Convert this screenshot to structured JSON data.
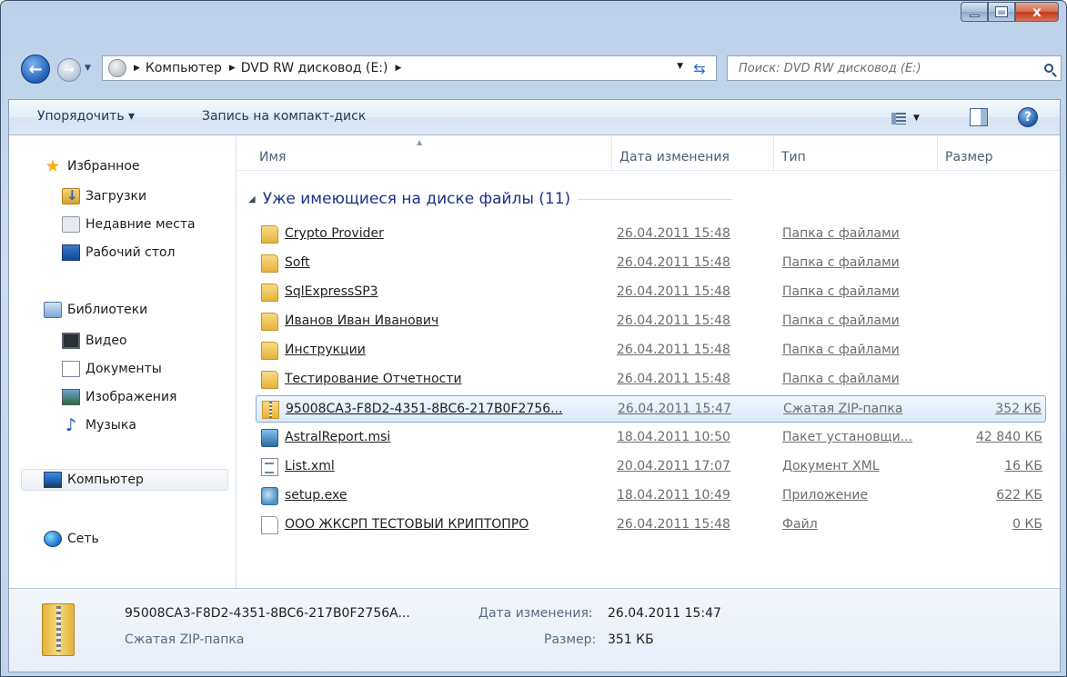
{
  "titlebar": {
    "minimize_icon": "minimize-icon",
    "maximize_icon": "maximize-icon",
    "close_glyph": "x"
  },
  "address": {
    "crumbs": [
      "Компьютер",
      "DVD RW дисковод (E:)"
    ],
    "search_placeholder": "Поиск: DVD RW дисковод (E:)"
  },
  "toolbar": {
    "organize_label": "Упорядочить ▾",
    "burn_label": "Запись на компакт-диск",
    "help_glyph": "?"
  },
  "nav": {
    "favorites": "Избранное",
    "downloads": "Загрузки",
    "recent": "Недавние места",
    "desktop": "Рабочий стол",
    "libraries": "Библиотеки",
    "video": "Видео",
    "documents": "Документы",
    "images": "Изображения",
    "music": "Музыка",
    "computer": "Компьютер",
    "network": "Сеть"
  },
  "columns": {
    "name": "Имя",
    "date": "Дата изменения",
    "type": "Тип",
    "size": "Размер"
  },
  "group": {
    "label": "Уже имеющиеся на диске файлы (11)"
  },
  "files": [
    {
      "name": "Crypto Provider",
      "date": "26.04.2011 15:48",
      "type": "Папка с файлами",
      "size": ""
    },
    {
      "name": "Soft",
      "date": "26.04.2011 15:48",
      "type": "Папка с файлами",
      "size": ""
    },
    {
      "name": "SqlExpressSP3",
      "date": "26.04.2011 15:48",
      "type": "Папка с файлами",
      "size": ""
    },
    {
      "name": "Иванов Иван Иванович",
      "date": "26.04.2011 15:48",
      "type": "Папка с файлами",
      "size": ""
    },
    {
      "name": "Инструкции",
      "date": "26.04.2011 15:48",
      "type": "Папка с файлами",
      "size": ""
    },
    {
      "name": "Тестирование Отчетности",
      "date": "26.04.2011 15:48",
      "type": "Папка с файлами",
      "size": ""
    },
    {
      "name": "95008CA3-F8D2-4351-8BC6-217B0F2756...",
      "date": "26.04.2011 15:47",
      "type": "Сжатая ZIP-папка",
      "size": "352 КБ"
    },
    {
      "name": "AstralReport.msi",
      "date": "18.04.2011 10:50",
      "type": "Пакет установщи...",
      "size": "42 840 КБ"
    },
    {
      "name": "List.xml",
      "date": "20.04.2011 17:07",
      "type": "Документ XML",
      "size": "16 КБ"
    },
    {
      "name": "setup.exe",
      "date": "18.04.2011 10:49",
      "type": "Приложение",
      "size": "622 КБ"
    },
    {
      "name": "ООО ЖКСРП ТЕСТОВЫЙ КРИПТОПРО",
      "date": "26.04.2011 15:48",
      "type": "Файл",
      "size": "0 КБ"
    }
  ],
  "details": {
    "name": "95008CA3-F8D2-4351-8BC6-217B0F2756A...",
    "type": "Сжатая ZIP-папка",
    "modified_label": "Дата изменения:",
    "modified_value": "26.04.2011 15:47",
    "size_label": "Размер:",
    "size_value": "351 КБ"
  }
}
